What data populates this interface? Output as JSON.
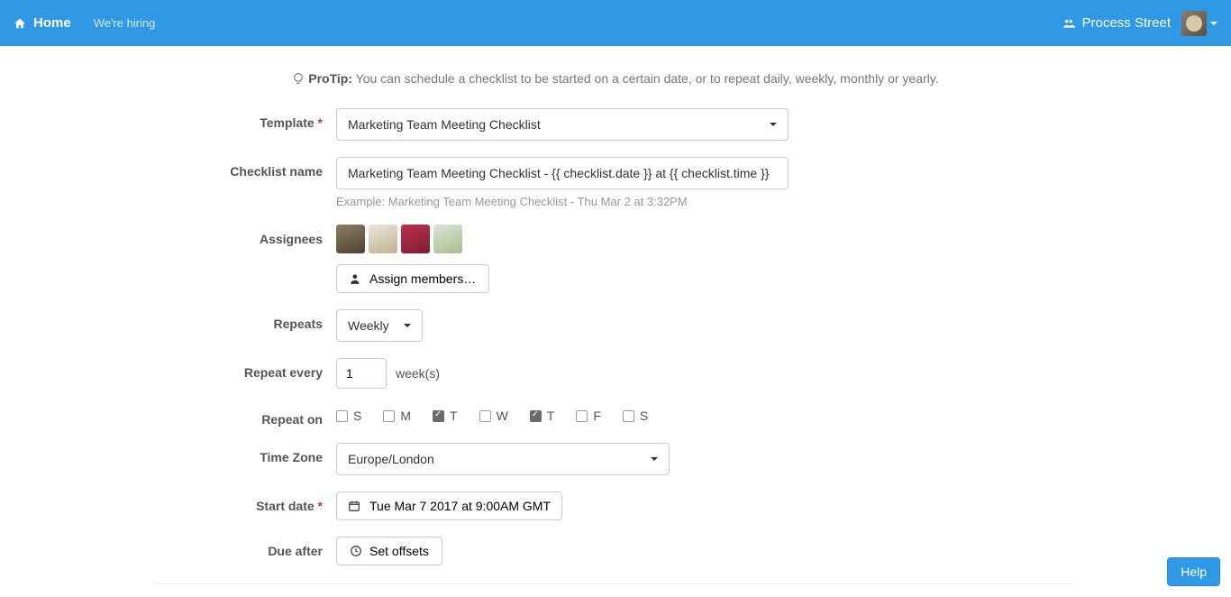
{
  "nav": {
    "home": "Home",
    "hiring": "We're hiring",
    "brand": "Process Street"
  },
  "protip": {
    "label": "ProTip:",
    "text": "You can schedule a checklist to be started on a certain date, or to repeat daily, weekly, monthly or yearly."
  },
  "labels": {
    "template": "Template",
    "checklistName": "Checklist name",
    "assignees": "Assignees",
    "repeats": "Repeats",
    "repeatEvery": "Repeat every",
    "repeatOn": "Repeat on",
    "timeZone": "Time Zone",
    "startDate": "Start date",
    "dueAfter": "Due after"
  },
  "template": {
    "value": "Marketing Team Meeting Checklist"
  },
  "checklistName": {
    "value": "Marketing Team Meeting Checklist - {{ checklist.date }} at {{ checklist.time }}",
    "example": "Example: Marketing Team Meeting Checklist - Thu Mar 2 at 3:32PM"
  },
  "assignees": {
    "assignBtn": "Assign members…",
    "count": 4
  },
  "repeats": {
    "value": "Weekly"
  },
  "repeatEvery": {
    "value": "1",
    "unit": "week(s)"
  },
  "repeatOn": {
    "days": [
      {
        "label": "S",
        "checked": false
      },
      {
        "label": "M",
        "checked": false
      },
      {
        "label": "T",
        "checked": true
      },
      {
        "label": "W",
        "checked": false
      },
      {
        "label": "T",
        "checked": true
      },
      {
        "label": "F",
        "checked": false
      },
      {
        "label": "S",
        "checked": false
      }
    ]
  },
  "timeZone": {
    "value": "Europe/London"
  },
  "startDate": {
    "value": "Tue Mar 7 2017 at 9:00AM GMT"
  },
  "dueAfter": {
    "btn": "Set offsets"
  },
  "help": "Help"
}
